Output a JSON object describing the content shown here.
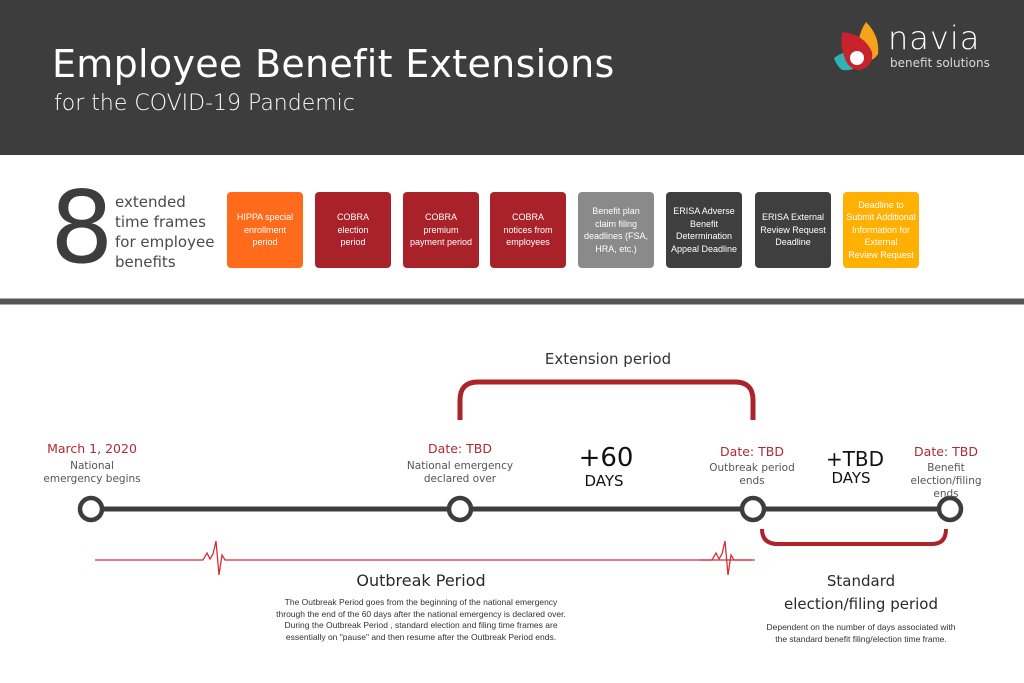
{
  "header": {
    "title": "Employee Benefit Extensions",
    "subtitle": "for the COVID-19 Pandemic",
    "logo_word": "navia",
    "logo_tagline": "benefit solutions"
  },
  "summary": {
    "count": "8",
    "lines": [
      "extended",
      "time frames",
      "for employee",
      "benefits"
    ]
  },
  "boxes": [
    {
      "label": "HIPPA special\nenrollment\nperiod",
      "color": "#ff6b1a"
    },
    {
      "label": "COBRA\nelection\nperiod",
      "color": "#a9222a"
    },
    {
      "label": "COBRA\npremium\npayment period",
      "color": "#a9222a"
    },
    {
      "label": "COBRA\nnotices from\nemployees",
      "color": "#a9222a"
    },
    {
      "label": "Benefit plan\nclaim filing\ndeadlines (FSA,\nHRA, etc.)",
      "color": "#8a8a8a"
    },
    {
      "label": "ERISA Adverse\nBenefit\nDetermination\nAppeal Deadline",
      "color": "#3f3f3f"
    },
    {
      "label": "ERISA External\nReview Request\nDeadline",
      "color": "#3f3f3f"
    },
    {
      "label": "Deadline to\nSubmit Additional\nInformation for\nExternal\nReview Request",
      "color": "#ffb000"
    }
  ],
  "timeline": {
    "extension_label": "Extension period",
    "milestones": [
      {
        "date": "March 1, 2020",
        "desc": "National\nemergency begins"
      },
      {
        "date": "Date: TBD",
        "desc": "National emergency\ndeclared over"
      },
      {
        "date": "Date: TBD",
        "desc": "Outbreak period\nends"
      },
      {
        "date": "Date: TBD",
        "desc": "Benefit\nelection/filing ends"
      }
    ],
    "intervals": [
      {
        "amount": "+60",
        "unit": "DAYS"
      },
      {
        "amount": "+TBD",
        "unit": "DAYS"
      }
    ],
    "outbreak": {
      "title": "Outbreak Period",
      "desc": "The Outbreak Period goes from the beginning of the national emergency\nthrough the end of the 60 days after the national emergency is declared over.\nDuring the Outbreak Period , standard election and filing time frames are\nessentially on \"pause\" and then resume after the Outbreak Period ends."
    },
    "standard": {
      "title": "Standard\nelection/filing period",
      "desc": "Dependent on the number of days associated with\nthe standard benefit filing/election time frame."
    }
  },
  "colors": {
    "header_bg": "#3d3d3d",
    "accent_red": "#b02a30",
    "orange": "#ff6b1a",
    "cobra_red": "#a9222a",
    "gray": "#8a8a8a",
    "dark": "#3f3f3f",
    "yellow": "#ffb000"
  }
}
